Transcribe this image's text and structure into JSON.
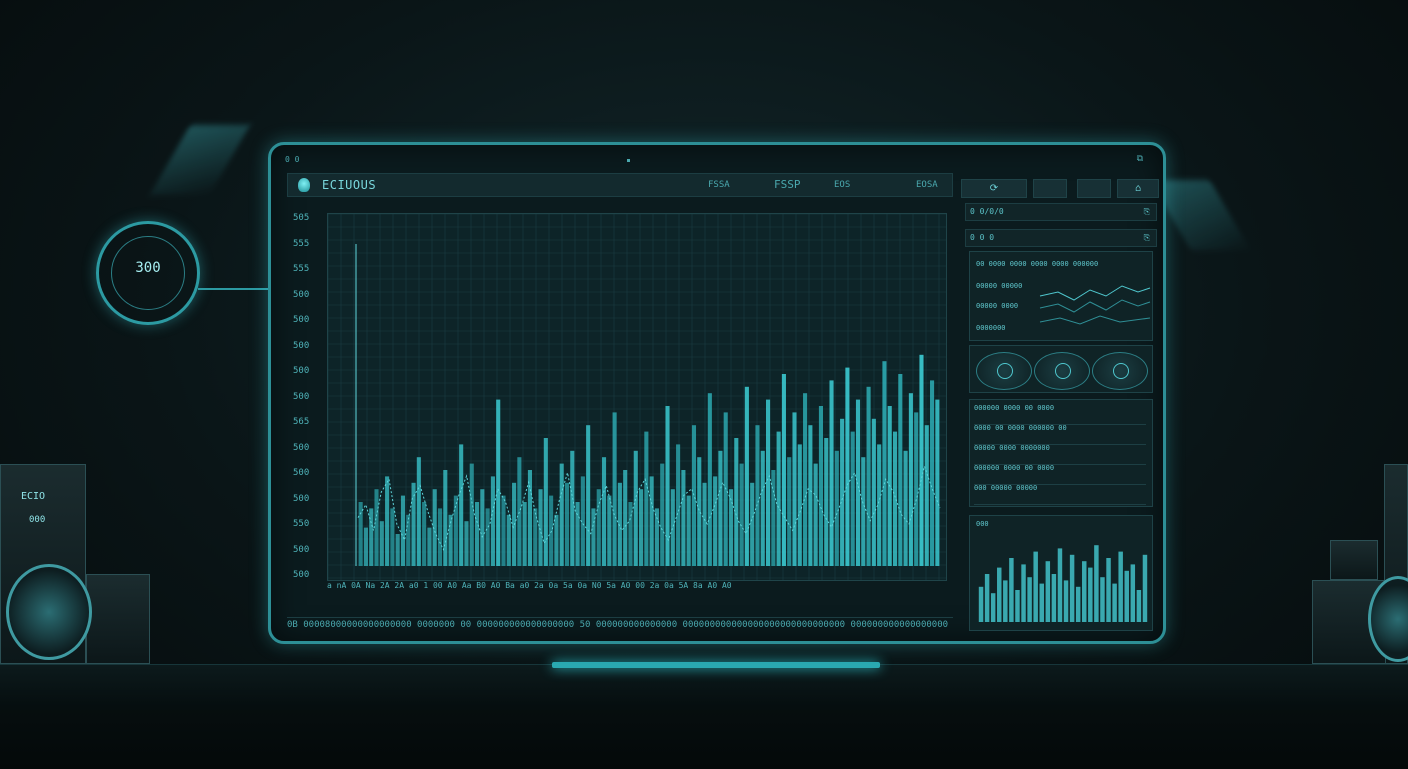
{
  "gauge": {
    "value": "300"
  },
  "app": {
    "brand": "ECIUOUS",
    "header_tabs": [
      "FSSA",
      "FSSP",
      "EOS",
      "EOSA"
    ],
    "header_buttons": [
      "⟳",
      "",
      "",
      "⌂"
    ]
  },
  "main_chart": {
    "y_tick_labels": [
      "505",
      "555",
      "555",
      "500",
      "500",
      "500",
      "500",
      "500",
      "565",
      "500",
      "500",
      "500",
      "550",
      "500",
      "500"
    ],
    "x_tick_labels": "a nA 0A Na 2A 2A a0 1 00 A0 Aa B0 A0 Ba a0 2a 0a 5a 0a N0 5a A0 00 2a 0a 5A 8a A0 A0",
    "bottom_strip": "0B 00008000000000000000 0000000 00 000000000000000000 50 000000000000000 000000000000000000000000000000 000000000000000000 000000000 000000"
  },
  "chart_data": {
    "type": "bar",
    "values": [
      10,
      6,
      9,
      12,
      7,
      14,
      9,
      5,
      11,
      8,
      13,
      17,
      10,
      6,
      12,
      9,
      15,
      8,
      11,
      19,
      7,
      16,
      10,
      12,
      9,
      14,
      26,
      11,
      8,
      13,
      17,
      10,
      15,
      9,
      12,
      20,
      11,
      8,
      16,
      13,
      18,
      10,
      14,
      22,
      9,
      12,
      17,
      11,
      24,
      13,
      15,
      10,
      18,
      12,
      21,
      14,
      9,
      16,
      25,
      12,
      19,
      15,
      11,
      22,
      17,
      13,
      27,
      14,
      18,
      24,
      12,
      20,
      16,
      28,
      13,
      22,
      18,
      26,
      15,
      21,
      30,
      17,
      24,
      19,
      27,
      22,
      16,
      25,
      20,
      29,
      18,
      23,
      31,
      21,
      26,
      17,
      28,
      23,
      19,
      32,
      25,
      21,
      30,
      18,
      27,
      24,
      33,
      22,
      29,
      26
    ],
    "line_values": [
      62,
      66,
      58,
      70,
      74,
      60,
      55,
      68,
      72,
      64,
      57,
      52,
      61,
      69,
      75,
      63,
      56,
      60,
      71,
      67,
      59,
      65,
      73,
      62,
      54,
      58,
      68,
      76,
      64,
      60,
      57,
      66,
      72,
      63,
      58,
      61,
      70,
      74,
      65,
      59,
      55,
      62,
      69,
      71,
      64,
      60,
      66,
      73,
      68,
      61,
      57,
      63,
      70,
      75,
      66,
      62,
      58,
      64,
      71,
      69,
      63,
      59,
      65,
      72,
      76,
      67,
      61,
      66,
      74,
      70,
      63,
      60,
      68,
      78,
      71,
      65
    ]
  },
  "right_panel": {
    "row1": {
      "label": "0 0/0/0",
      "icon": "⎘"
    },
    "row2": {
      "label": "0 0 0",
      "icon": "⎘"
    },
    "trend_labels": [
      "00 0000 0000 0000 0000 000000",
      "00000 00000",
      "00000 0000",
      "0000000"
    ],
    "table_rows": [
      "000000 0000 00 0000",
      "0000 00 0000 000000 00",
      "00000 0000 0000000",
      "000000 0000 00 0000",
      "000 00000 00000"
    ],
    "bars_label": "000",
    "bar_values": [
      22,
      30,
      18,
      34,
      26,
      40,
      20,
      36,
      28,
      44,
      24,
      38,
      30,
      46,
      26,
      42,
      22,
      38,
      34,
      48,
      28,
      40,
      24,
      44,
      32,
      36,
      20,
      42
    ]
  },
  "left_device": {
    "label": "ECIO",
    "sub": "000"
  }
}
